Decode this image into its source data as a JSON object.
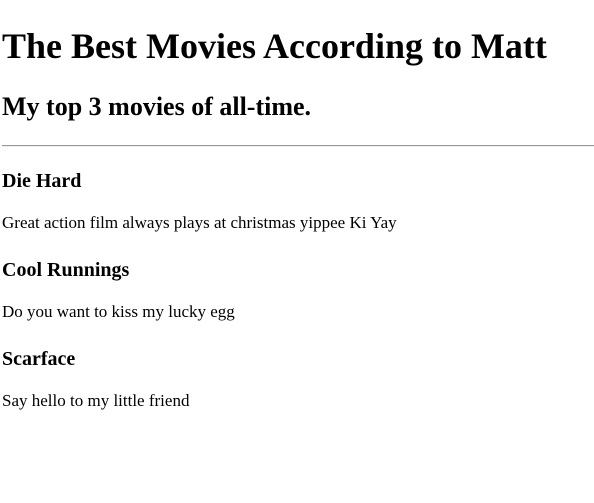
{
  "header": {
    "title": "The Best Movies According to Matt",
    "subtitle": "My top 3 movies of all-time."
  },
  "movies": [
    {
      "title": "Die Hard",
      "description": "Great action film always plays at christmas yippee Ki Yay"
    },
    {
      "title": "Cool Runnings",
      "description": "Do you want to kiss my lucky egg"
    },
    {
      "title": "Scarface",
      "description": "Say hello to my little friend"
    }
  ]
}
